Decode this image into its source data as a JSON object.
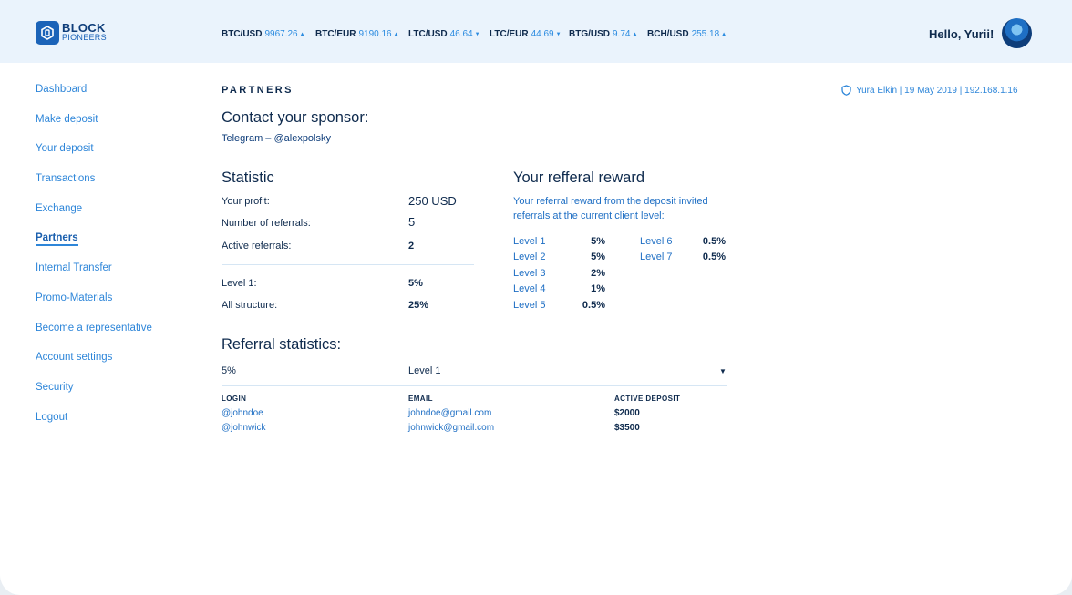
{
  "brand": {
    "line1": "BLOCK",
    "line2": "PIONEERS"
  },
  "tickers": [
    {
      "pair": "BTC/USD",
      "price": "9967.26",
      "direction": "up"
    },
    {
      "pair": "BTC/EUR",
      "price": "9190.16",
      "direction": "up"
    },
    {
      "pair": "LTC/USD",
      "price": "46.64",
      "direction": "down"
    },
    {
      "pair": "LTC/EUR",
      "price": "44.69",
      "direction": "down"
    },
    {
      "pair": "BTG/USD",
      "price": "9.74",
      "direction": "up"
    },
    {
      "pair": "BCH/USD",
      "price": "255.18",
      "direction": "up"
    }
  ],
  "user": {
    "greeting": "Hello, Yurii!"
  },
  "sidebar": {
    "items": [
      {
        "label": "Dashboard"
      },
      {
        "label": "Make deposit"
      },
      {
        "label": "Your deposit"
      },
      {
        "label": "Transactions"
      },
      {
        "label": "Exchange"
      },
      {
        "label": "Partners",
        "active": true
      },
      {
        "label": "Internal Transfer"
      },
      {
        "label": "Promo-Materials"
      },
      {
        "label": "Become a representative"
      },
      {
        "label": "Account settings"
      },
      {
        "label": "Security"
      },
      {
        "label": "Logout"
      }
    ]
  },
  "page": {
    "title": "PARTNERS",
    "session_info": "Yura Elkin | 19 May 2019 | 192.168.1.16"
  },
  "sponsor": {
    "heading": "Contact your sponsor:",
    "contact": "Telegram – @alexpolsky"
  },
  "statistic": {
    "heading": "Statistic",
    "profit_label": "Your profit:",
    "profit_value": "250 USD",
    "referrals_label": "Number of referrals:",
    "referrals_value": "5",
    "active_label": "Active referrals:",
    "active_value": "2",
    "level1_label": "Level 1:",
    "level1_value": "5%",
    "structure_label": "All structure:",
    "structure_value": "25%"
  },
  "reward": {
    "heading": "Your refferal reward",
    "description_line1": "Your referral reward from the deposit invited",
    "description_line2": "referrals at the current client level:",
    "levels": [
      {
        "name": "Level 1",
        "pct": "5%"
      },
      {
        "name": "Level 2",
        "pct": "5%"
      },
      {
        "name": "Level 3",
        "pct": "2%"
      },
      {
        "name": "Level 4",
        "pct": "1%"
      },
      {
        "name": "Level 5",
        "pct": "0.5%"
      },
      {
        "name": "Level 6",
        "pct": "0.5%"
      },
      {
        "name": "Level 7",
        "pct": "0.5%"
      }
    ]
  },
  "referral_stats": {
    "heading": "Referral statistics:",
    "filter_pct": "5%",
    "filter_level": "Level 1",
    "columns": [
      "LOGIN",
      "EMAIL",
      "ACTIVE DEPOSIT"
    ],
    "rows": [
      {
        "login": "@johndoe",
        "email": "johndoe@gmail.com",
        "deposit": "$2000"
      },
      {
        "login": "@johnwick",
        "email": "johnwick@gmail.com",
        "deposit": "$3500"
      }
    ]
  },
  "colors": {
    "accent": "#2e86d9",
    "dark": "#0e2a4d",
    "header_bg": "#eaf3fc"
  },
  "icons": [
    "logo-mark-icon",
    "arrow-up-icon",
    "arrow-down-icon",
    "shield-icon",
    "chevron-down-icon"
  ]
}
